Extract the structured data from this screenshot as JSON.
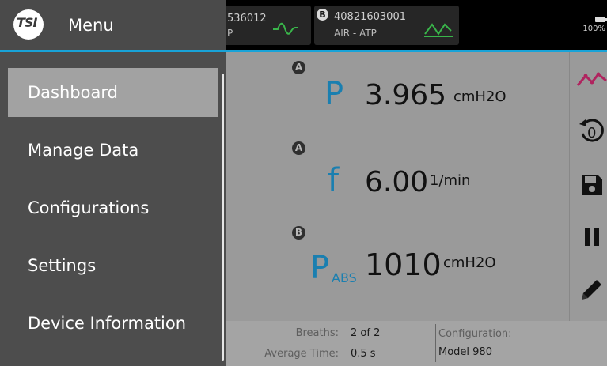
{
  "menu": {
    "title": "Menu",
    "logo_text": "TSI",
    "items": [
      {
        "label": "Dashboard",
        "active": true
      },
      {
        "label": "Manage Data"
      },
      {
        "label": "Configurations"
      },
      {
        "label": "Settings"
      },
      {
        "label": "Device Information"
      }
    ]
  },
  "devices": [
    {
      "serial": "536012",
      "sub": "P",
      "badge": ""
    },
    {
      "serial": "40821603001",
      "sub": "AIR - ATP",
      "badge": "B"
    }
  ],
  "battery": {
    "percent": "100%"
  },
  "readings": [
    {
      "badge": "A",
      "symbol": "P",
      "subscript": "",
      "value": "3.965",
      "unit": "cmH2O"
    },
    {
      "badge": "A",
      "symbol": "f",
      "subscript": "",
      "value": "6.00",
      "unit": "1/min"
    },
    {
      "badge": "B",
      "symbol": "P",
      "subscript": "ABS",
      "value": "1010",
      "unit": "cmH2O"
    }
  ],
  "toolbar": {
    "icons": [
      "trend-chart-icon",
      "zero-reset-icon",
      "save-icon",
      "pause-icon",
      "edit-icon"
    ]
  },
  "footer": {
    "breaths_label": "Breaths:",
    "breaths_value": "2 of 2",
    "avg_time_label": "Average Time:",
    "avg_time_value": "0.5 s",
    "config_label": "Configuration:",
    "config_value": "Model 980"
  },
  "colors": {
    "accent": "#18a3d8",
    "symbol": "#1a7fb0",
    "trend": "#b0245f"
  }
}
